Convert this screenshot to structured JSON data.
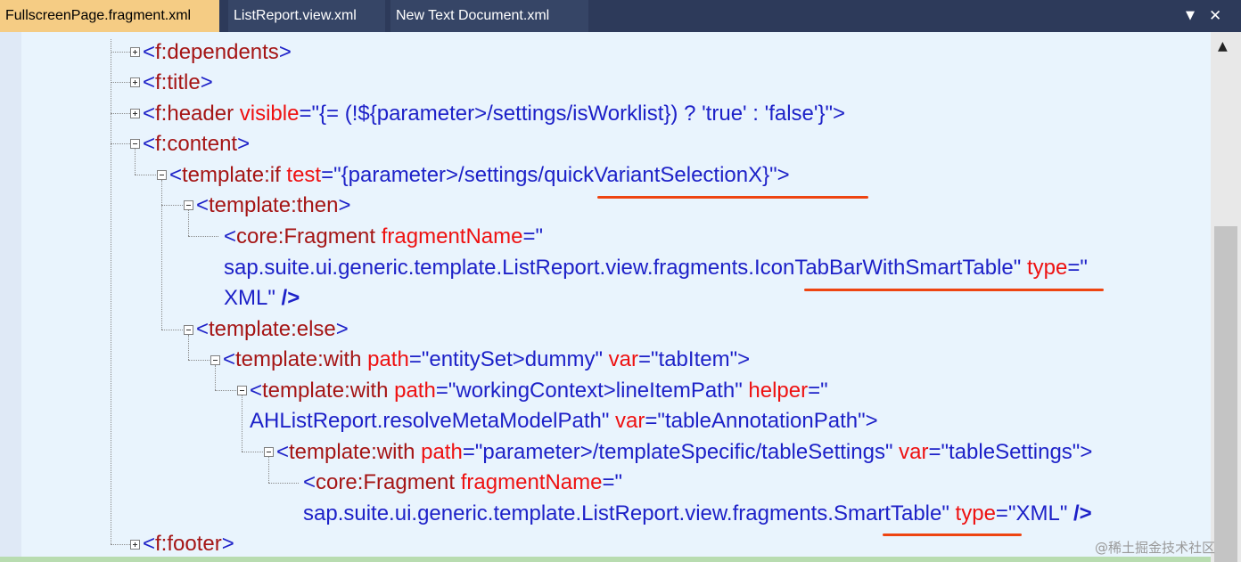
{
  "tabs": [
    {
      "label": "FullscreenPage.fragment.xml",
      "active": true
    },
    {
      "label": "ListReport.view.xml",
      "active": false
    },
    {
      "label": "New Text Document.xml",
      "active": false
    }
  ],
  "window_controls": {
    "dropdown_icon": "▼",
    "close_icon": "✕"
  },
  "colors": {
    "tag_bracket": "#1d21c8",
    "tag_name": "#a51515",
    "attribute": "#ee1111",
    "value": "#1d21c8",
    "underline": "#ee4411"
  },
  "code": {
    "l1": {
      "tag": "f:dependents"
    },
    "l2": {
      "tag": "f:title"
    },
    "l3": {
      "tag": "f:header",
      "attr": "visible",
      "value": "{= (!${parameter>/settings/isWorklist}) ? 'true' : 'false'}"
    },
    "l4": {
      "tag": "f:content"
    },
    "l5": {
      "tag": "template:if",
      "attr": "test",
      "value_a": "{parameter>/settings/",
      "value_b": "quickVariantSelectionX}"
    },
    "l6": {
      "tag": "template:then"
    },
    "l7": {
      "tag": "core:Fragment",
      "attr": "fragmentName"
    },
    "l8": {
      "value_a": "sap.suite.ui.generic.template.ListReport.view.fragments.",
      "value_b": "IconTabBarWithSmartTable",
      "attr2": "type"
    },
    "l9": {
      "value": "XML",
      "close": "/>"
    },
    "l10": {
      "tag": "template:else"
    },
    "l11": {
      "tag": "template:with",
      "attr": "path",
      "value": "entitySet>dummy",
      "attr2": "var",
      "value2": "tabItem"
    },
    "l12": {
      "tag": "template:with",
      "attr": "path",
      "value": "workingContext>lineItemPath",
      "attr2": "helper"
    },
    "l13": {
      "value": "AHListReport.resolveMetaModelPath",
      "attr2": "var",
      "value2": "tableAnnotationPath"
    },
    "l14": {
      "tag": "template:with",
      "attr": "path",
      "value": "parameter>/templateSpecific/tableSettings",
      "attr2": "var",
      "value2": "tableSettings"
    },
    "l15": {
      "tag": "core:Fragment",
      "attr": "fragmentName"
    },
    "l16": {
      "value_a": "sap.suite.ui.generic.template.ListReport.view.fragments.",
      "value_b": "SmartTable",
      "attr2": "type",
      "value2": "XML",
      "close": "/>"
    },
    "l17": {
      "tag": "f:footer"
    }
  },
  "watermark": "@稀土掘金技术社区"
}
